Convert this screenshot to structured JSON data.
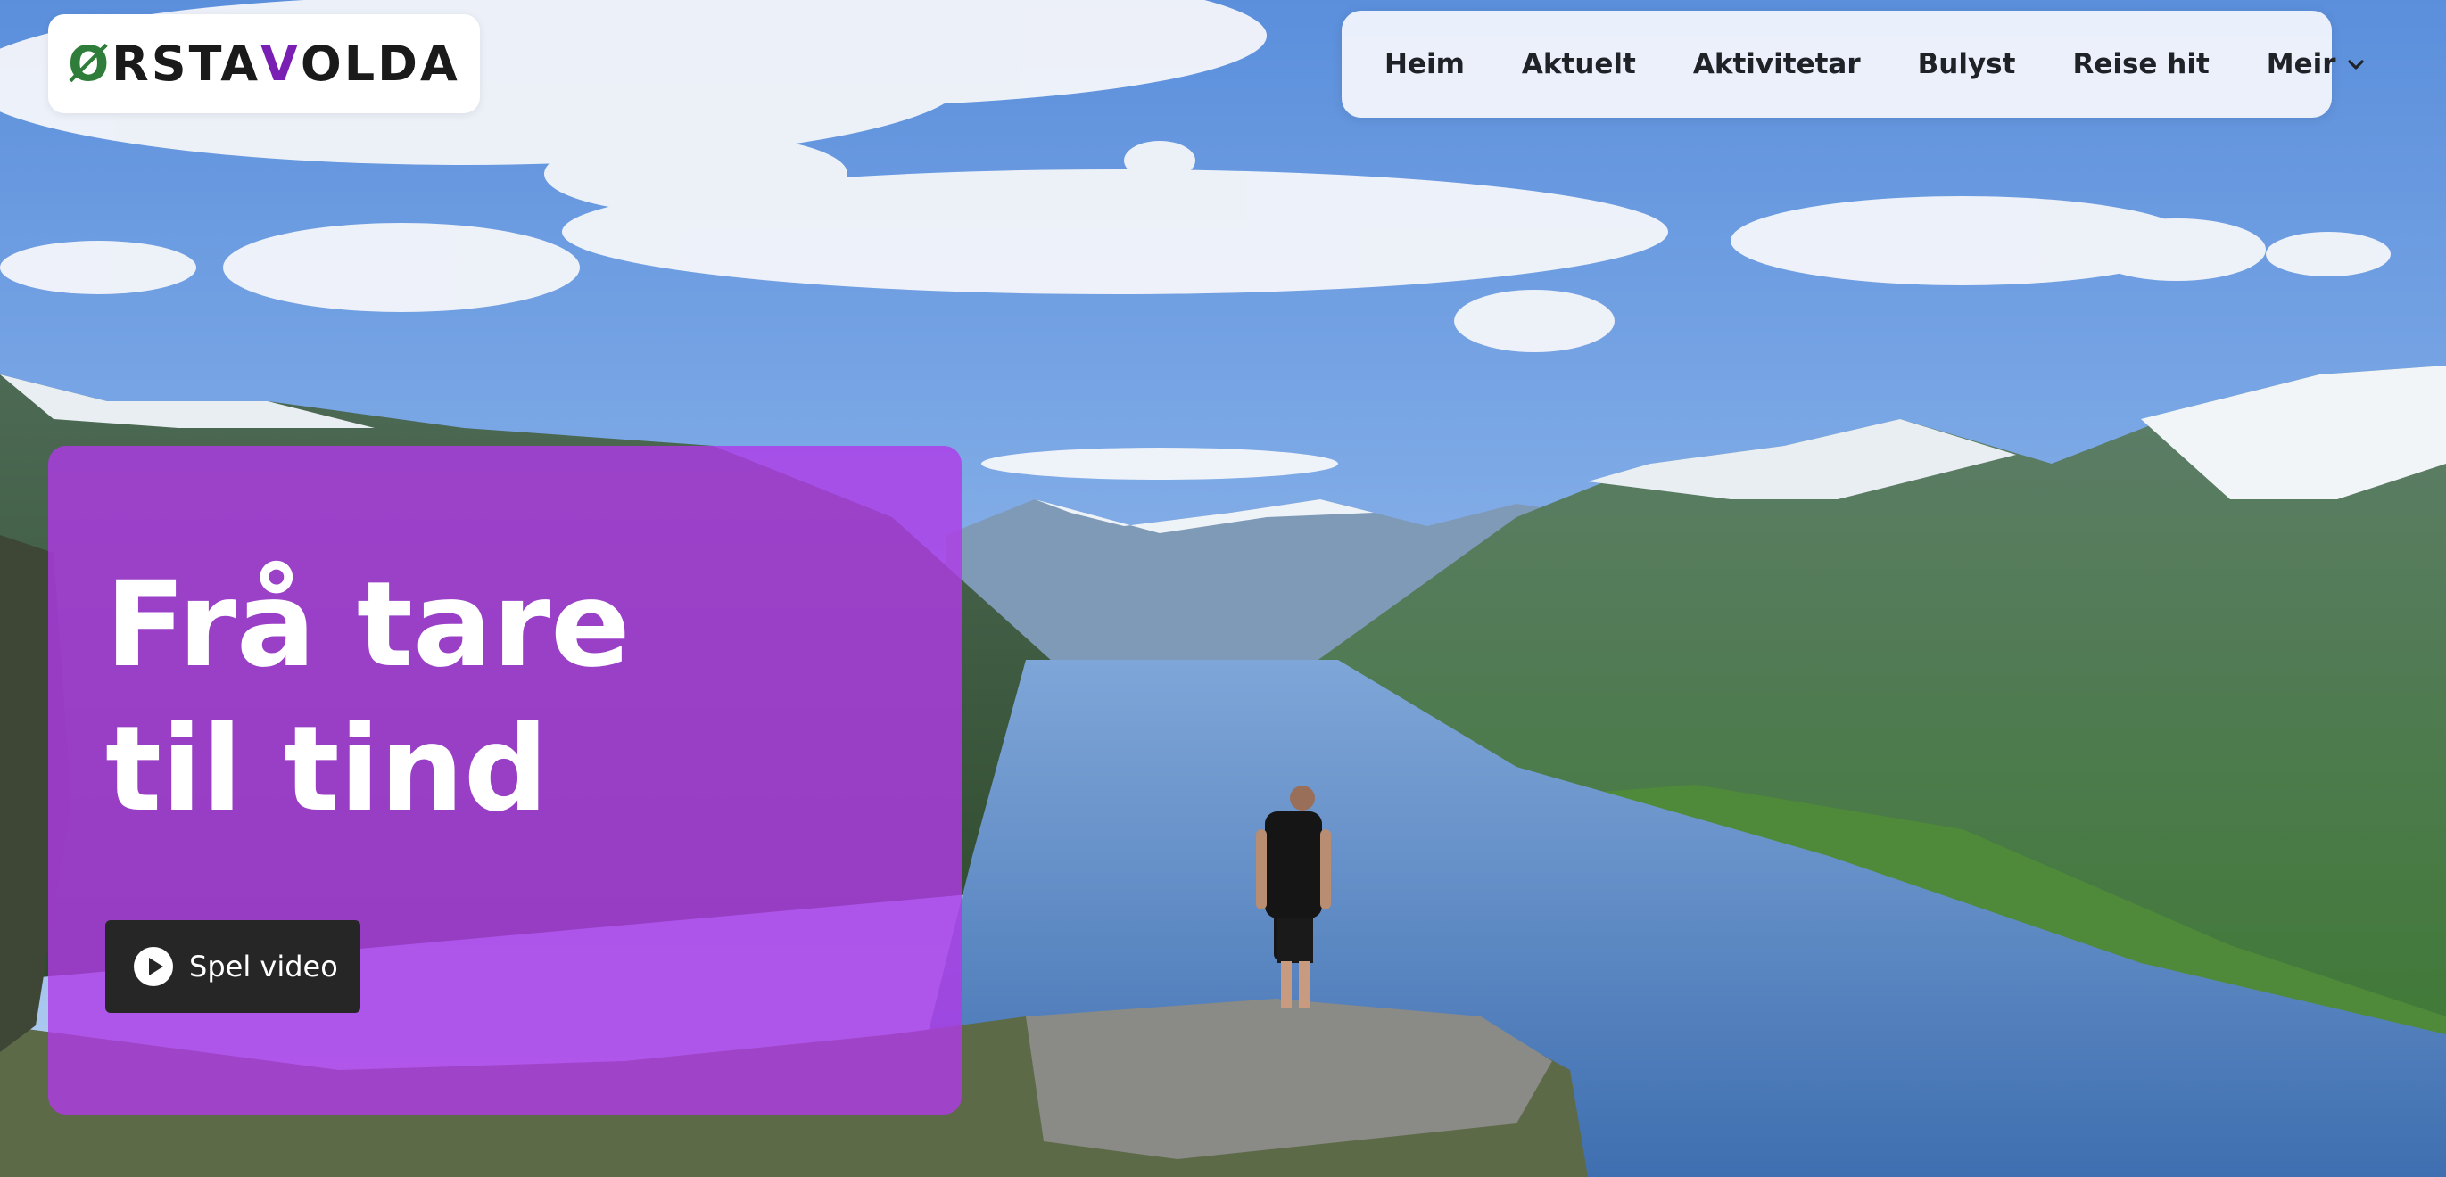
{
  "header": {
    "logo": {
      "first": "Ø",
      "part1": "RSTA",
      "mid": "V",
      "part2": "OLDA"
    }
  },
  "nav": {
    "items": [
      {
        "label": "Heim"
      },
      {
        "label": "Aktuelt"
      },
      {
        "label": "Aktivitetar"
      },
      {
        "label": "Bulyst"
      },
      {
        "label": "Reise hit"
      }
    ],
    "more_label": "Meir",
    "more_icon": "chevron-down-icon"
  },
  "hero": {
    "title": "Frå tare til tind",
    "play_label": "Spel video",
    "play_icon": "play-icon",
    "card_color": "#b03ae8"
  },
  "colors": {
    "sky_top": "#5b8fdc",
    "sky_bottom": "#a9c8ef",
    "fjord_water": "#5d86c2",
    "nav_bg": "#f0f4fc",
    "button_bg": "#262626"
  }
}
